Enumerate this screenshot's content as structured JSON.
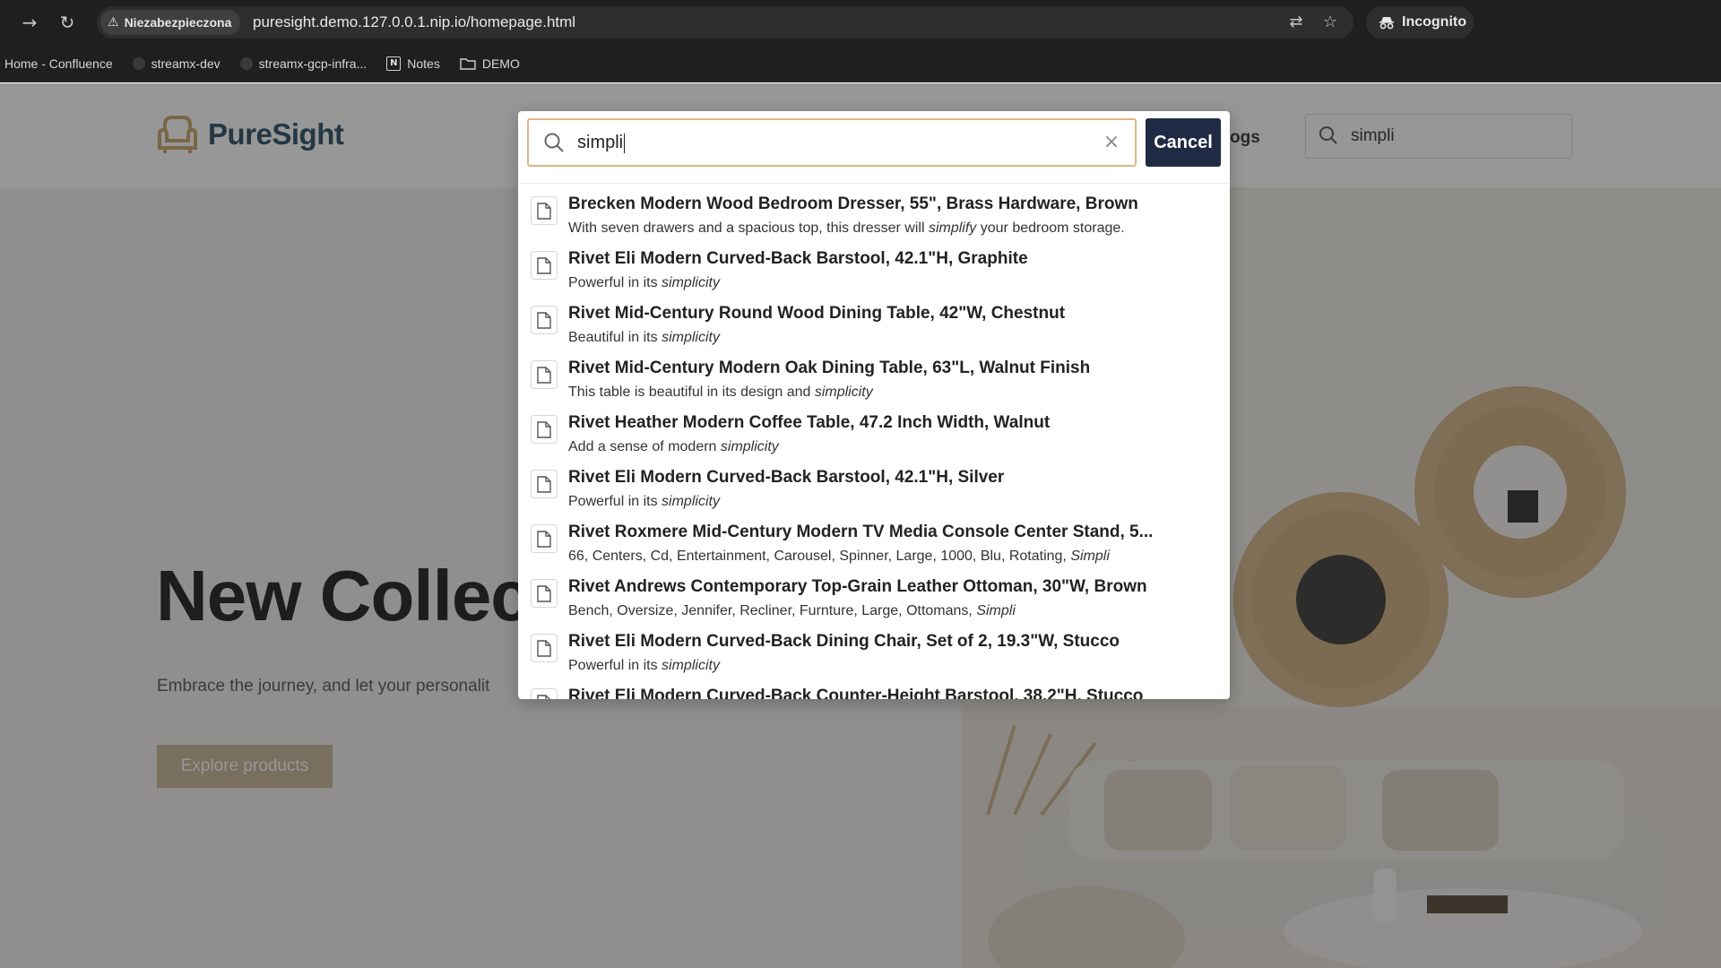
{
  "browser": {
    "security_label": "Niezabezpieczona",
    "url": "puresight.demo.127.0.0.1.nip.io/homepage.html",
    "incognito_label": "Incognito",
    "bookmarks": [
      {
        "label": "Home - Confluence",
        "icon": "none"
      },
      {
        "label": "streamx-dev",
        "icon": "github-icon"
      },
      {
        "label": "streamx-gcp-infra...",
        "icon": "github-icon"
      },
      {
        "label": "Notes",
        "icon": "notion-icon"
      },
      {
        "label": "DEMO",
        "icon": "folder-icon"
      }
    ]
  },
  "site": {
    "logo_text": "PureSight",
    "nav_partial": "ogs",
    "header_search_value": "simpli",
    "hero_title": "New Collec",
    "hero_subtitle": "Embrace the journey, and let your personalit",
    "hero_button": "Explore products"
  },
  "search_modal": {
    "query": "simpli",
    "cancel_label": "Cancel",
    "results": [
      {
        "title": "Brecken Modern Wood Bedroom Dresser, 55\", Brass Hardware, Brown",
        "desc_before": "With seven drawers and a spacious top, this dresser will ",
        "desc_match": "simplify",
        "desc_after": " your bedroom storage."
      },
      {
        "title": "Rivet Eli Modern Curved-Back Barstool, 42.1\"H, Graphite",
        "desc_before": "Powerful in its ",
        "desc_match": "simplicity",
        "desc_after": ""
      },
      {
        "title": "Rivet Mid-Century Round Wood Dining Table, 42\"W, Chestnut",
        "desc_before": "Beautiful in its ",
        "desc_match": "simplicity",
        "desc_after": ""
      },
      {
        "title": "Rivet Mid-Century Modern Oak Dining Table, 63\"L, Walnut Finish",
        "desc_before": "This table is beautiful in its design and ",
        "desc_match": "simplicity",
        "desc_after": ""
      },
      {
        "title": "Rivet Heather Modern Coffee Table, 47.2 Inch Width, Walnut",
        "desc_before": "Add a sense of modern ",
        "desc_match": "simplicity",
        "desc_after": ""
      },
      {
        "title": "Rivet Eli Modern Curved-Back Barstool, 42.1\"H, Silver",
        "desc_before": "Powerful in its ",
        "desc_match": "simplicity",
        "desc_after": ""
      },
      {
        "title": "Rivet Roxmere Mid-Century Modern TV Media Console Center Stand, 5...",
        "desc_before": "66, Centers, Cd, Entertainment, Carousel, Spinner, Large, 1000, Blu, Rotating, ",
        "desc_match": "Simpli",
        "desc_after": ""
      },
      {
        "title": "Rivet Andrews Contemporary Top-Grain Leather Ottoman, 30\"W, Brown",
        "desc_before": "Bench, Oversize, Jennifer, Recliner, Furnture, Large, Ottomans, ",
        "desc_match": "Simpli",
        "desc_after": ""
      },
      {
        "title": "Rivet Eli Modern Curved-Back Dining Chair, Set of 2, 19.3\"W, Stucco",
        "desc_before": "Powerful in its ",
        "desc_match": "simplicity",
        "desc_after": ""
      },
      {
        "title": "Rivet Eli Modern Curved-Back Counter-Height Barstool, 38.2\"H, Stucco",
        "desc_before": "",
        "desc_match": "",
        "desc_after": ""
      }
    ]
  },
  "colors": {
    "brand": "#2b4e66",
    "cancel_button": "#202a44",
    "input_focus_border": "#d9b982",
    "hero_button": "#c7b697"
  }
}
